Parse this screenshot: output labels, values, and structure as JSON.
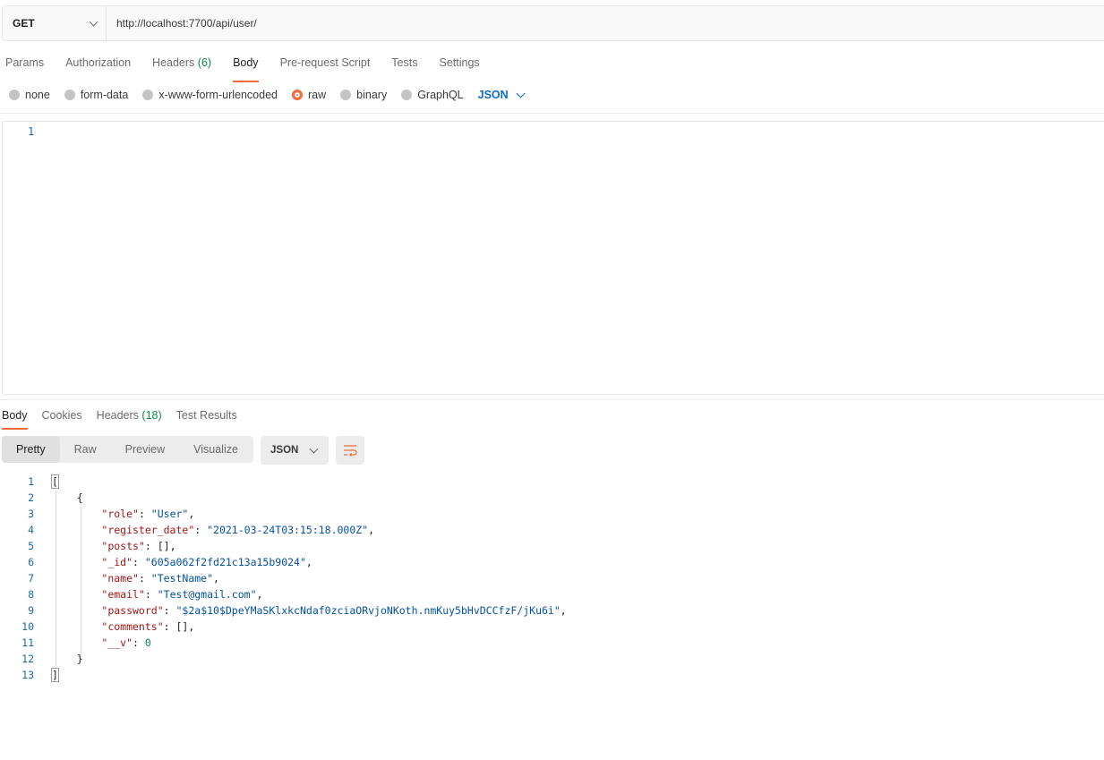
{
  "request": {
    "method": "GET",
    "url": "http://localhost:7700/api/user/",
    "tabs": [
      {
        "label": "Params"
      },
      {
        "label": "Authorization"
      },
      {
        "label": "Headers",
        "count": "(6)"
      },
      {
        "label": "Body"
      },
      {
        "label": "Pre-request Script"
      },
      {
        "label": "Tests"
      },
      {
        "label": "Settings"
      }
    ],
    "active_tab": "Body",
    "body_types": [
      "none",
      "form-data",
      "x-www-form-urlencoded",
      "raw",
      "binary",
      "GraphQL"
    ],
    "selected_body_type": "raw",
    "body_format": "JSON",
    "editor_line_number": "1"
  },
  "response": {
    "tabs": [
      {
        "label": "Body"
      },
      {
        "label": "Cookies"
      },
      {
        "label": "Headers",
        "count": "(18)"
      },
      {
        "label": "Test Results"
      }
    ],
    "active_tab": "Body",
    "views": [
      "Pretty",
      "Raw",
      "Preview",
      "Visualize"
    ],
    "active_view": "Pretty",
    "format": "JSON",
    "lines": [
      {
        "n": "1",
        "open": "[",
        "indent": ""
      },
      {
        "n": "2",
        "open": "{",
        "indent": "    "
      },
      {
        "n": "3",
        "indent": "        ",
        "key": "\"role\"",
        "value": "\"User\"",
        "vtype": "str",
        "tail": ","
      },
      {
        "n": "4",
        "indent": "        ",
        "key": "\"register_date\"",
        "value": "\"2021-03-24T03:15:18.000Z\"",
        "vtype": "str",
        "tail": ","
      },
      {
        "n": "5",
        "indent": "        ",
        "key": "\"posts\"",
        "value": "[]",
        "vtype": "plain",
        "tail": ","
      },
      {
        "n": "6",
        "indent": "        ",
        "key": "\"_id\"",
        "value": "\"605a062f2fd21c13a15b9024\"",
        "vtype": "str",
        "tail": ","
      },
      {
        "n": "7",
        "indent": "        ",
        "key": "\"name\"",
        "value": "\"TestName\"",
        "vtype": "str",
        "tail": ","
      },
      {
        "n": "8",
        "indent": "        ",
        "key": "\"email\"",
        "value": "\"Test@gmail.com\"",
        "vtype": "str",
        "tail": ","
      },
      {
        "n": "9",
        "indent": "        ",
        "key": "\"password\"",
        "value": "\"$2a$10$DpeYMaSKlxkcNdaf0zciaORvjoNKoth.nmKuy5bHvDCCfzF/jKu6i\"",
        "vtype": "str",
        "tail": ","
      },
      {
        "n": "10",
        "indent": "        ",
        "key": "\"comments\"",
        "value": "[]",
        "vtype": "plain",
        "tail": ","
      },
      {
        "n": "11",
        "indent": "        ",
        "key": "\"__v\"",
        "value": "0",
        "vtype": "num",
        "tail": ""
      },
      {
        "n": "12",
        "open": "}",
        "indent": "    "
      },
      {
        "n": "13",
        "open": "]",
        "indent": ""
      }
    ]
  },
  "colors": {
    "accent": "#f26b3a",
    "count_green": "#0f8a4a",
    "link_blue": "#0d6bcc",
    "json_key": "#a31515",
    "json_string": "#0451a5",
    "json_number": "#098658"
  }
}
